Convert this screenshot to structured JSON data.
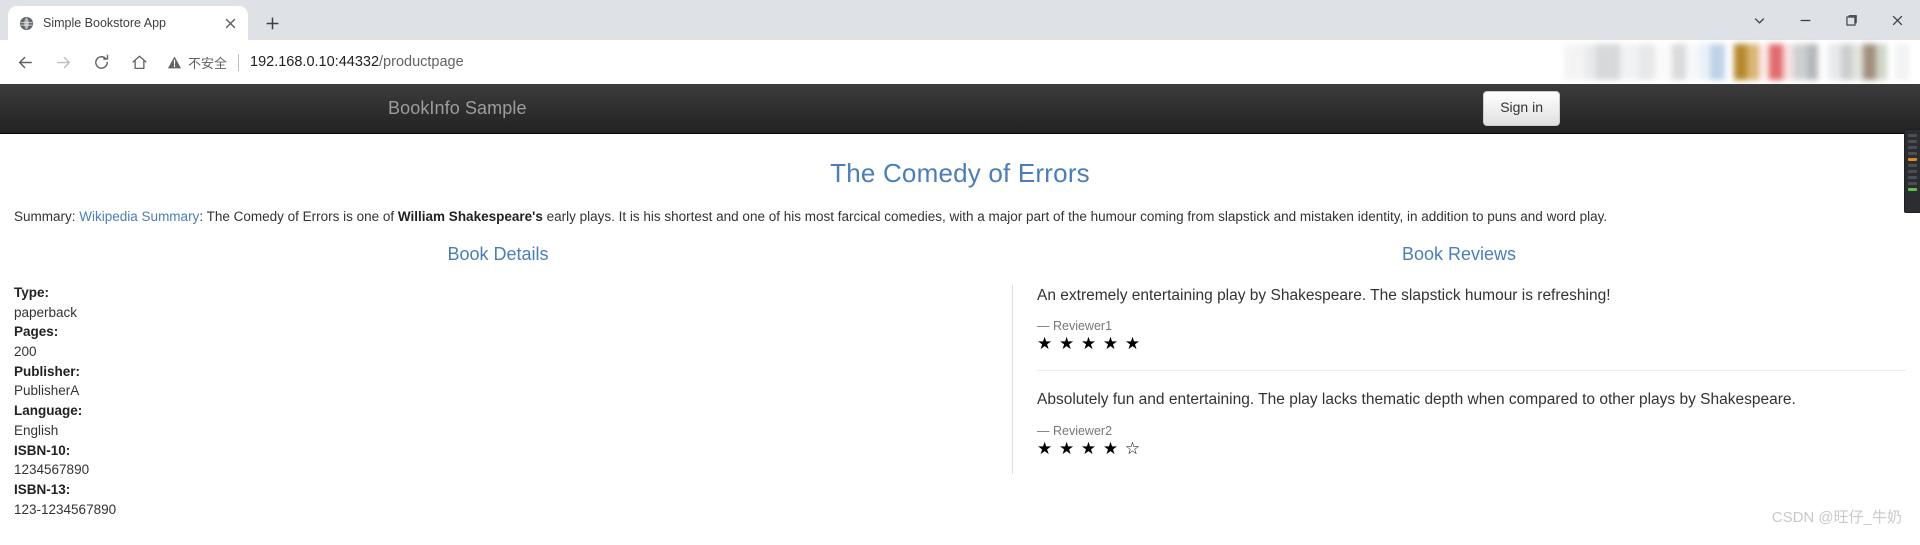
{
  "browser": {
    "tab": {
      "title": "Simple Bookstore App",
      "favicon_icon": "globe-icon",
      "close_icon": "close-icon"
    },
    "new_tab_label": "+",
    "window_controls": [
      {
        "name": "chevron-down-icon",
        "label": "⌄"
      },
      {
        "name": "minimize-icon",
        "label": "—"
      },
      {
        "name": "maximize-icon",
        "label": "❑"
      },
      {
        "name": "close-window-icon",
        "label": "✕"
      }
    ],
    "nav": {
      "back_icon": "back-arrow-icon",
      "forward_icon": "forward-arrow-icon",
      "reload_icon": "reload-icon",
      "home_icon": "home-icon"
    },
    "omnibox": {
      "warning_icon": "warning-triangle-icon",
      "security_text": "不安全",
      "url_host": "192.168.0.10:44332",
      "url_path": "/productpage",
      "url_full": "192.168.0.10:44332/productpage"
    }
  },
  "site": {
    "navbar": {
      "brand": "BookInfo Sample",
      "signin_label": "Sign in"
    },
    "book": {
      "title": "The Comedy of Errors",
      "summary_label": "Summary:",
      "summary_link": "Wikipedia Summary",
      "summary_colon": ":",
      "summary_text_1": " The Comedy of Errors is one of ",
      "summary_bold": "William Shakespeare's",
      "summary_text_2": " early plays. It is his shortest and one of his most farcical comedies, with a major part of the humour coming from slapstick and mistaken identity, in addition to puns and word play."
    },
    "details": {
      "heading": "Book Details",
      "rows": [
        {
          "label": "Type:",
          "value": "paperback"
        },
        {
          "label": "Pages:",
          "value": "200"
        },
        {
          "label": "Publisher:",
          "value": "PublisherA"
        },
        {
          "label": "Language:",
          "value": "English"
        },
        {
          "label": "ISBN-10:",
          "value": "1234567890"
        },
        {
          "label": "ISBN-13:",
          "value": "123-1234567890"
        }
      ]
    },
    "reviews": {
      "heading": "Book Reviews",
      "items": [
        {
          "text": "An extremely entertaining play by Shakespeare. The slapstick humour is refreshing!",
          "author": "— Reviewer1",
          "rating": 5,
          "stars": "★ ★ ★ ★ ★"
        },
        {
          "text": "Absolutely fun and entertaining. The play lacks thematic depth when compared to other plays by Shakespeare.",
          "author": "— Reviewer2",
          "rating": 4,
          "stars": "★ ★ ★ ★ ☆"
        }
      ]
    }
  },
  "watermark": "CSDN @旺仔_牛奶",
  "colors": {
    "accent_link": "#4a7ebb",
    "navbar_bg": "#222222",
    "chrome_bg": "#dee1e6",
    "text": "#333333"
  }
}
